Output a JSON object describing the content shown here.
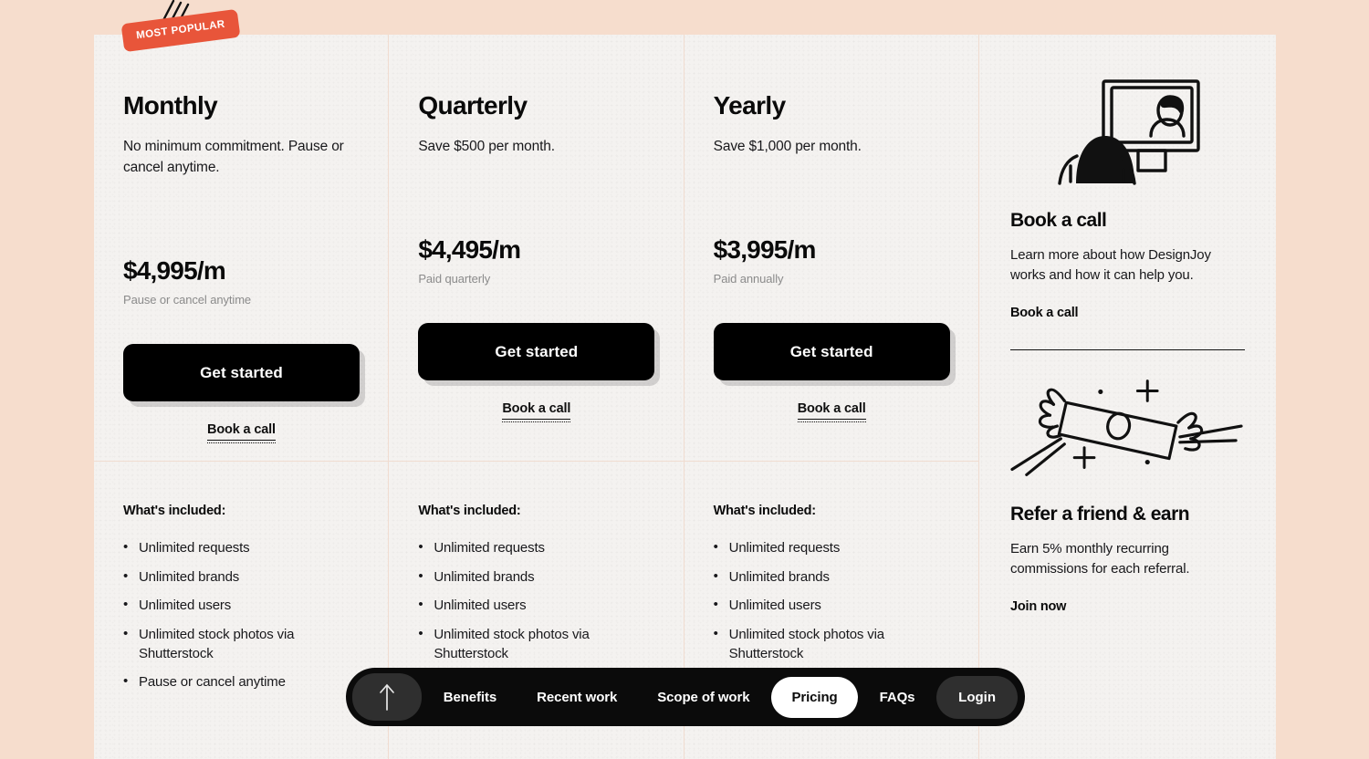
{
  "badge": {
    "label": "MOST POPULAR"
  },
  "plans": [
    {
      "name": "Monthly",
      "description": "No minimum commitment. Pause or cancel anytime.",
      "price": "$4,995/m",
      "price_note": "Pause or cancel anytime",
      "cta_label": "Get started",
      "secondary_label": "Book a call",
      "included_title": "What's included:",
      "features": [
        "Unlimited requests",
        "Unlimited brands",
        "Unlimited users",
        "Unlimited stock photos via Shutterstock",
        "Pause or cancel anytime"
      ]
    },
    {
      "name": "Quarterly",
      "description": "Save $500 per month.",
      "price": "$4,495/m",
      "price_note": "Paid quarterly",
      "cta_label": "Get started",
      "secondary_label": "Book a call",
      "included_title": "What's included:",
      "features": [
        "Unlimited requests",
        "Unlimited brands",
        "Unlimited users",
        "Unlimited stock photos via Shutterstock"
      ]
    },
    {
      "name": "Yearly",
      "description": "Save $1,000 per month.",
      "price": "$3,995/m",
      "price_note": "Paid annually",
      "cta_label": "Get started",
      "secondary_label": "Book a call",
      "included_title": "What's included:",
      "features": [
        "Unlimited requests",
        "Unlimited brands",
        "Unlimited users",
        "Unlimited stock photos via Shutterstock"
      ]
    }
  ],
  "side": {
    "book_call": {
      "title": "Book a call",
      "description": "Learn more about how DesignJoy works and how it can help you.",
      "link_label": "Book a call"
    },
    "refer": {
      "title": "Refer a friend & earn",
      "description": "Earn 5% monthly recurring commissions for each referral.",
      "link_label": "Join now"
    }
  },
  "nav": {
    "scroll_top_icon": "arrow-up-icon",
    "links": [
      {
        "label": "Benefits",
        "active": false
      },
      {
        "label": "Recent work",
        "active": false
      },
      {
        "label": "Scope of work",
        "active": false
      },
      {
        "label": "Pricing",
        "active": true
      },
      {
        "label": "FAQs",
        "active": false
      }
    ],
    "login_label": "Login"
  },
  "colors": {
    "page_background": "#f6ddcd",
    "card_background": "#f4f2f0",
    "badge": "#e8553a",
    "nav": "#0b0b0b",
    "divider": "#f0dcd0"
  }
}
